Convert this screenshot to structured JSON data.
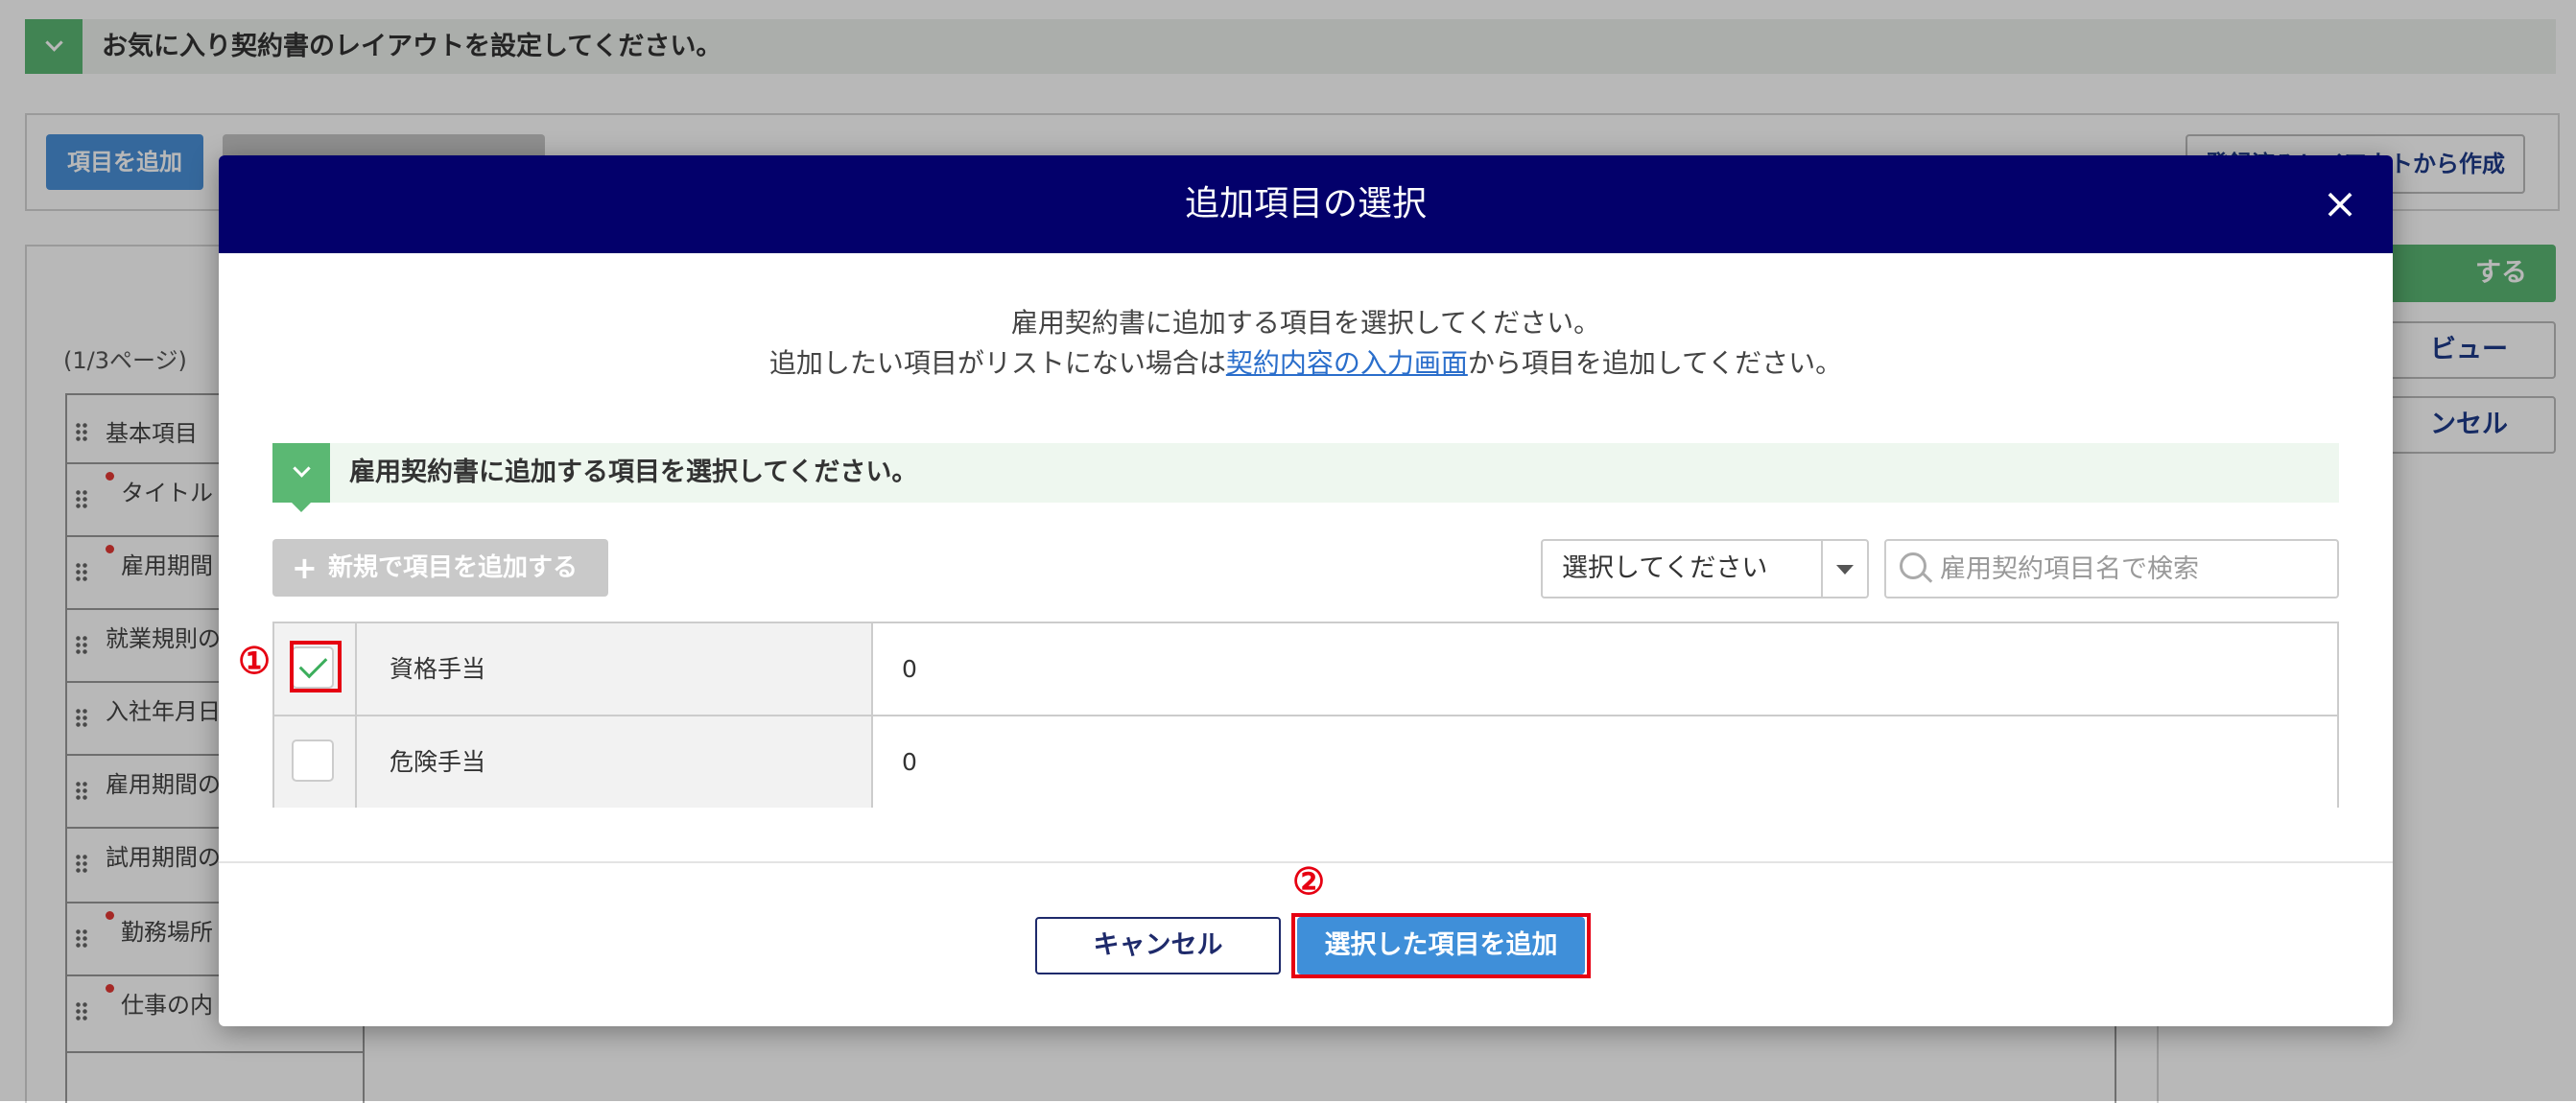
{
  "background": {
    "banner_text": "お気に入り契約書のレイアウトを設定してください。",
    "toolbar": {
      "add_item_label": "項目を追加",
      "create_from_layout_label": "登録済みレイアウトから作成"
    },
    "page_count": "(1/3ページ)",
    "rows": [
      "基本項目",
      "タイトル",
      "雇用期間",
      "就業規則の",
      "入社年月日",
      "雇用期間の",
      "試用期間の",
      "勤務場所",
      "仕事の内"
    ],
    "side": {
      "save_label": "する",
      "preview_label": "ビュー",
      "cancel_label": "ンセル"
    }
  },
  "modal": {
    "title": "追加項目の選択",
    "close_glyph": "×",
    "intro_line1": "雇用契約書に追加する項目を選択してください。",
    "intro_line2_before": "追加したい項目がリストにない場合は",
    "intro_link": "契約内容の入力画面",
    "intro_line2_after": "から項目を追加してください。",
    "section_title": "雇用契約書に追加する項目を選択してください。",
    "new_item_button": "新規で項目を追加する",
    "select_value": "選択してください",
    "search_placeholder": "雇用契約項目名で検索",
    "items": [
      {
        "name": "資格手当",
        "value": "0",
        "checked": true
      },
      {
        "name": "危険手当",
        "value": "0",
        "checked": false
      }
    ],
    "cancel_label": "キャンセル",
    "add_selected_label": "選択した項目を追加"
  },
  "annotations": {
    "marker1": "①",
    "marker2": "②",
    "highlight_color": "#e60012"
  },
  "colors": {
    "header_navy": "#03006b",
    "accent_green": "#5bb873",
    "primary_blue": "#3f8fd9"
  }
}
